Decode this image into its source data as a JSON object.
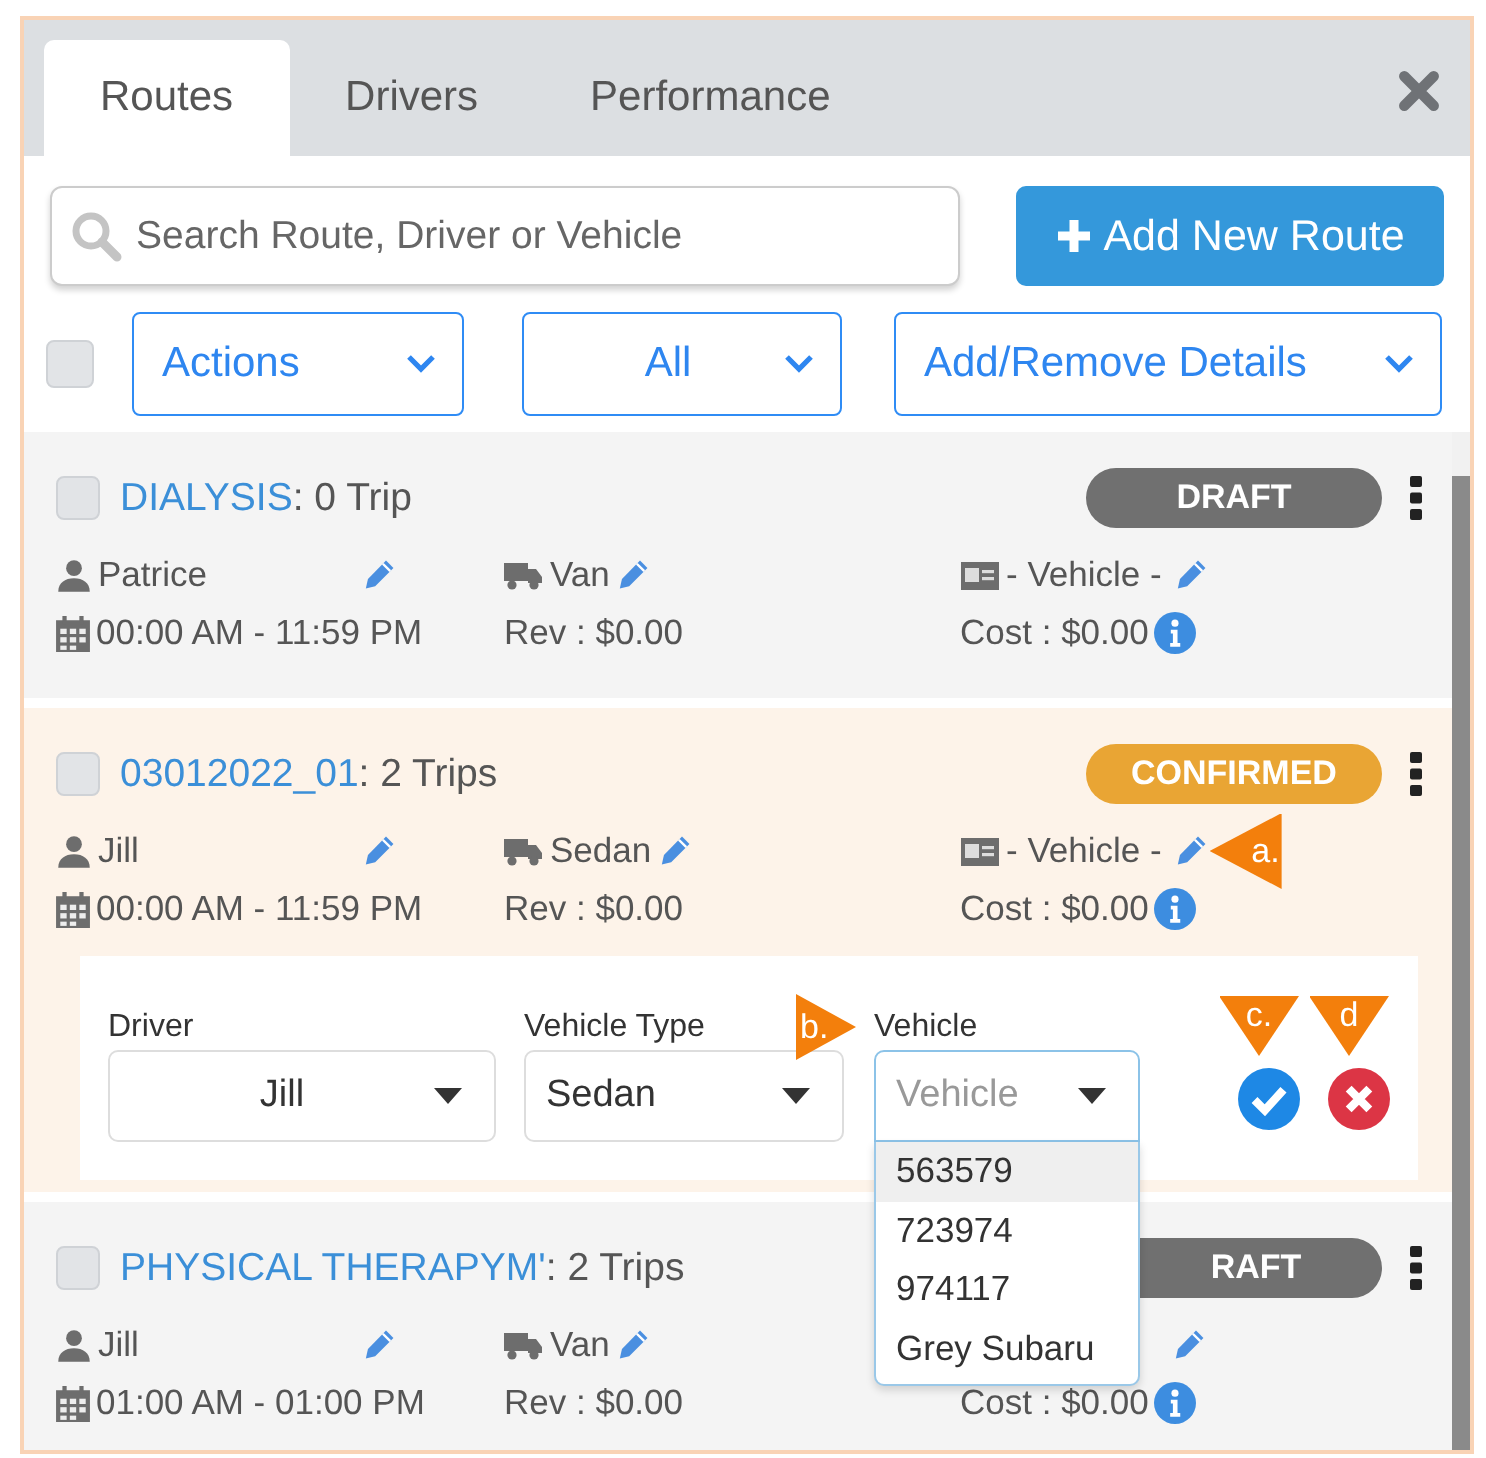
{
  "tabs": [
    {
      "label": "Routes",
      "selected": true
    },
    {
      "label": "Drivers",
      "selected": false
    },
    {
      "label": "Performance",
      "selected": false
    }
  ],
  "search": {
    "placeholder": "Search Route, Driver or Vehicle"
  },
  "add_button": {
    "label": "Add New Route"
  },
  "select_all": {
    "checked": false
  },
  "filters": [
    {
      "label": "Actions"
    },
    {
      "label": "All"
    },
    {
      "label": "Add/Remove Details"
    }
  ],
  "routes": [
    {
      "checked": false,
      "name": "DIALYSIS",
      "trips": ": 0 Trip",
      "status": {
        "label": "DRAFT",
        "kind": "draft"
      },
      "editing": false,
      "driver": "Patrice",
      "vehicle_type": "Van",
      "vehicle": "- Vehicle -",
      "time": "00:00 AM - 11:59 PM",
      "revenue": "Rev : $0.00",
      "cost": "Cost : $0.00"
    },
    {
      "checked": false,
      "name": "03012022_01",
      "trips": ": 2 Trips",
      "status": {
        "label": "CONFIRMED",
        "kind": "confirmed"
      },
      "editing": true,
      "driver": "Jill",
      "vehicle_type": "Sedan",
      "vehicle": "- Vehicle -",
      "vehicle_callout": "a.",
      "time": "00:00 AM - 11:59 PM",
      "revenue": "Rev : $0.00",
      "cost": "Cost : $0.00",
      "edit": {
        "fields": [
          {
            "label": "Driver",
            "value": "Jill",
            "open": false
          },
          {
            "label": "Vehicle Type",
            "value": "Sedan",
            "open": false
          },
          {
            "label": "Vehicle",
            "placeholder": "Vehicle",
            "open": true,
            "callout": "b.",
            "options": [
              {
                "label": "563579",
                "highlighted": true
              },
              {
                "label": "723974",
                "highlighted": false
              },
              {
                "label": "974117",
                "highlighted": false
              },
              {
                "label": "Grey Subaru",
                "highlighted": false
              }
            ]
          }
        ],
        "confirm": {
          "callout": "c."
        },
        "cancel": {
          "callout": "d"
        }
      }
    },
    {
      "checked": false,
      "name": "PHYSICAL THERAPYM'",
      "trips": ": 2 Trips",
      "status": {
        "label": "RAFT",
        "kind": "draft"
      },
      "editing": false,
      "driver": "Jill",
      "vehicle_type": "Van",
      "time": "01:00 AM - 01:00 PM",
      "revenue": "Rev : $0.00",
      "cost": "Cost : $0.00"
    }
  ]
}
